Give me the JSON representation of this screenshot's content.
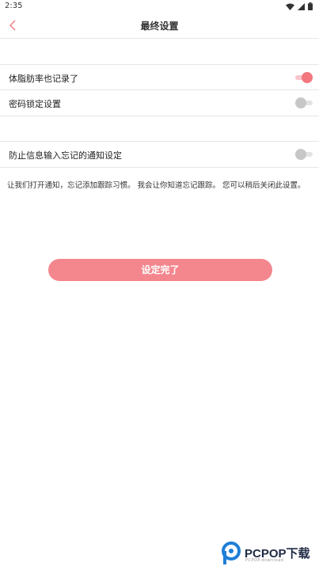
{
  "status_bar": {
    "time": "2:35",
    "icons": [
      "wifi-icon",
      "signal-icon",
      "battery-icon"
    ]
  },
  "header": {
    "title": "最终设置",
    "back_icon": "chevron-left-icon",
    "accent": "#f2777f"
  },
  "settings": [
    {
      "label": "体脂肪率也记录了",
      "enabled": true
    },
    {
      "label": "密码锁定设置",
      "enabled": false
    },
    {
      "label": "防止信息输入忘记的通知设定",
      "enabled": false
    }
  ],
  "note": "让我们打开通知，忘记添加跟踪习惯。 我会让你知道忘记跟踪。 您可以稍后关闭此设置。",
  "done_button": {
    "label": "设定完了",
    "color": "#f4868d"
  },
  "watermark": {
    "brand": "PCPOP下载",
    "subtitle": "PCPOP.download",
    "logo_icon": "pcpop-logo-icon"
  }
}
